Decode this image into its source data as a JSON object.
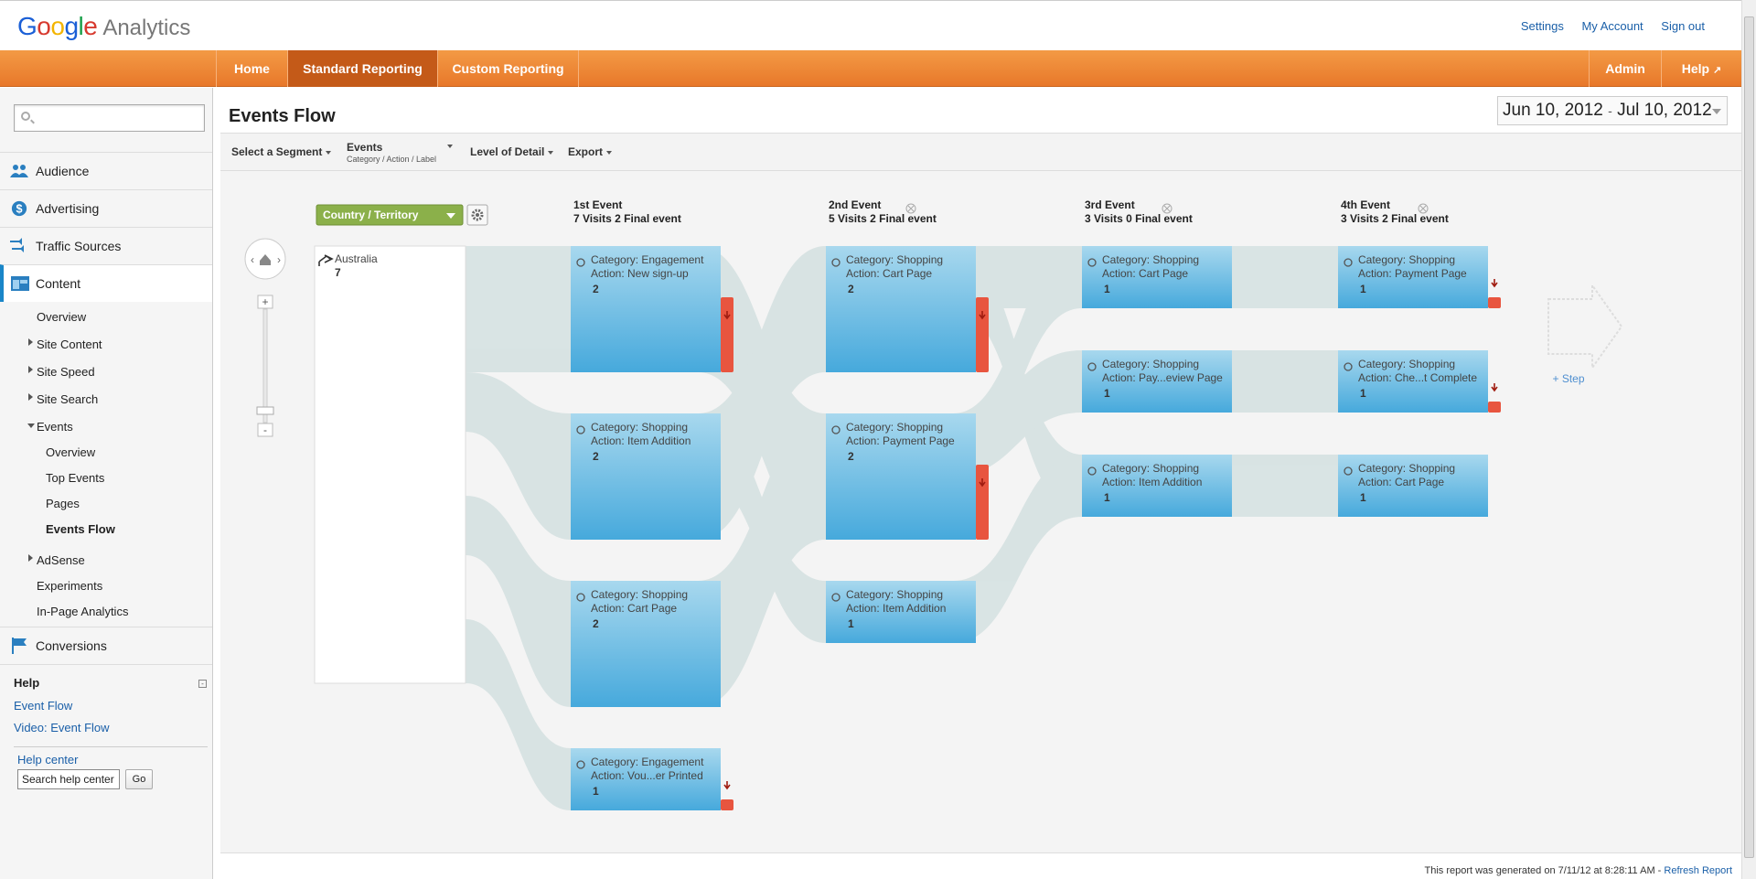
{
  "header": {
    "logo_brand": "Google",
    "logo_product": "Analytics",
    "links": [
      "Settings",
      "My Account",
      "Sign out"
    ]
  },
  "nav": {
    "tabs": [
      "Home",
      "Standard Reporting",
      "Custom Reporting"
    ],
    "active_tab": "Standard Reporting",
    "right": [
      "Admin",
      "Help"
    ]
  },
  "sidebar": {
    "sections": [
      "Audience",
      "Advertising",
      "Traffic Sources",
      "Content",
      "Conversions"
    ],
    "content_items": [
      "Overview",
      "Site Content",
      "Site Speed",
      "Site Search",
      "Events"
    ],
    "events_items": [
      "Overview",
      "Top Events",
      "Pages",
      "Events Flow"
    ],
    "more_items": [
      "AdSense",
      "Experiments",
      "In-Page Analytics"
    ],
    "help": {
      "title": "Help",
      "links": [
        "Event Flow",
        "Video: Event Flow"
      ],
      "center": "Help center",
      "search_value": "Search help center",
      "go": "Go"
    }
  },
  "main": {
    "title": "Events Flow",
    "date_start": "Jun 10, 2012",
    "date_sep": "-",
    "date_end": "Jul 10, 2012",
    "toolbar": {
      "segment": "Select a Segment",
      "events": "Events",
      "events_sub": "Category / Action / Label",
      "detail": "Level of Detail",
      "export": "Export"
    },
    "dimension": "Country / Territory",
    "footer_text": "This report was generated on 7/11/12 at 8:28:11 AM - ",
    "footer_link": "Refresh Report",
    "add_step": "+ Step"
  },
  "flow": {
    "source": {
      "name": "Australia",
      "count": "7"
    },
    "columns": [
      {
        "title": "1st Event",
        "sub": "7 Visits 2 Final event",
        "nodes": [
          {
            "cat": "Category: Engagement",
            "act": "Action: New sign-up",
            "count": "2",
            "dropoff": true
          },
          {
            "cat": "Category: Shopping",
            "act": "Action: Item Addition",
            "count": "2",
            "dropoff": false
          },
          {
            "cat": "Category: Shopping",
            "act": "Action: Cart Page",
            "count": "2",
            "dropoff": false
          },
          {
            "cat": "Category: Engagement",
            "act": "Action: Vou...er Printed",
            "count": "1",
            "dropoff": true
          }
        ]
      },
      {
        "title": "2nd Event",
        "sub": "5 Visits 2 Final event",
        "nodes": [
          {
            "cat": "Category: Shopping",
            "act": "Action: Cart Page",
            "count": "2",
            "dropoff": true
          },
          {
            "cat": "Category: Shopping",
            "act": "Action: Payment Page",
            "count": "2",
            "dropoff": true
          },
          {
            "cat": "Category: Shopping",
            "act": "Action: Item Addition",
            "count": "1",
            "dropoff": false
          }
        ]
      },
      {
        "title": "3rd Event",
        "sub": "3 Visits 0 Final event",
        "nodes": [
          {
            "cat": "Category: Shopping",
            "act": "Action: Cart Page",
            "count": "1",
            "dropoff": false
          },
          {
            "cat": "Category: Shopping",
            "act": "Action: Pay...eview Page",
            "count": "1",
            "dropoff": false
          },
          {
            "cat": "Category: Shopping",
            "act": "Action: Item Addition",
            "count": "1",
            "dropoff": false
          }
        ]
      },
      {
        "title": "4th Event",
        "sub": "3 Visits 2 Final event",
        "nodes": [
          {
            "cat": "Category: Shopping",
            "act": "Action: Payment Page",
            "count": "1",
            "dropoff": true
          },
          {
            "cat": "Category: Shopping",
            "act": "Action: Che...t Complete",
            "count": "1",
            "dropoff": true
          },
          {
            "cat": "Category: Shopping",
            "act": "Action: Cart Page",
            "count": "1",
            "dropoff": false
          }
        ]
      }
    ]
  },
  "colors": {
    "nav_orange": "#e8782a",
    "node_blue": "#4fb0de",
    "dropoff_red": "#e8553f",
    "flow_gray": "#d7e3e3",
    "dimension_green": "#8bb04a"
  }
}
